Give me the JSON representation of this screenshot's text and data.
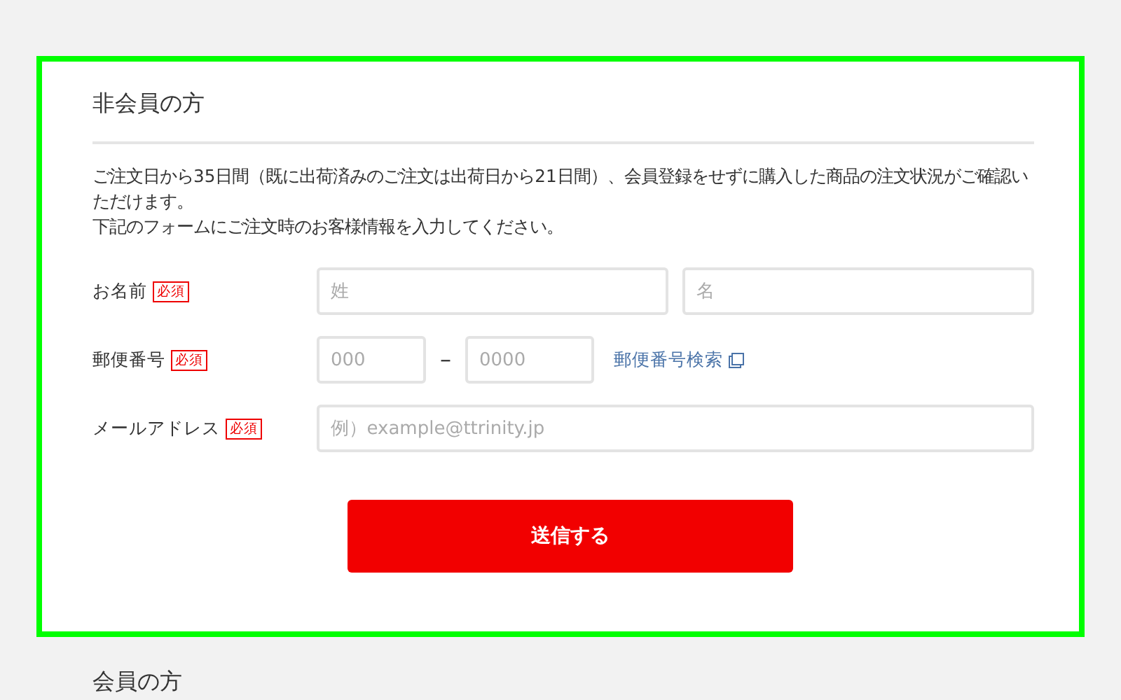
{
  "guest_section": {
    "title": "非会員の方",
    "description": [
      "ご注文日から35日間（既に出荷済みのご注文は出荷日から21日間）、会員登録をせずに購入した商品の注文状況がご確認いただけます。",
      "下記のフォームにご注文時のお客様情報を入力してください。"
    ],
    "fields": [
      {
        "kind": "name",
        "label": "お名前",
        "required_badge": "必須",
        "inputs": [
          {
            "placeholder": "姓"
          },
          {
            "placeholder": "名"
          }
        ]
      },
      {
        "kind": "postal",
        "label": "郵便番号",
        "required_badge": "必須",
        "inputs": [
          {
            "placeholder": "000"
          },
          {
            "placeholder": "0000"
          }
        ],
        "separator": "–",
        "link": "郵便番号検索"
      },
      {
        "kind": "email",
        "label": "メールアドレス",
        "required_badge": "必須",
        "inputs": [
          {
            "placeholder": "例）example@ttrinity.jp"
          }
        ]
      }
    ],
    "submit_button": "送信する"
  },
  "member_section": {
    "title": "会員の方"
  }
}
